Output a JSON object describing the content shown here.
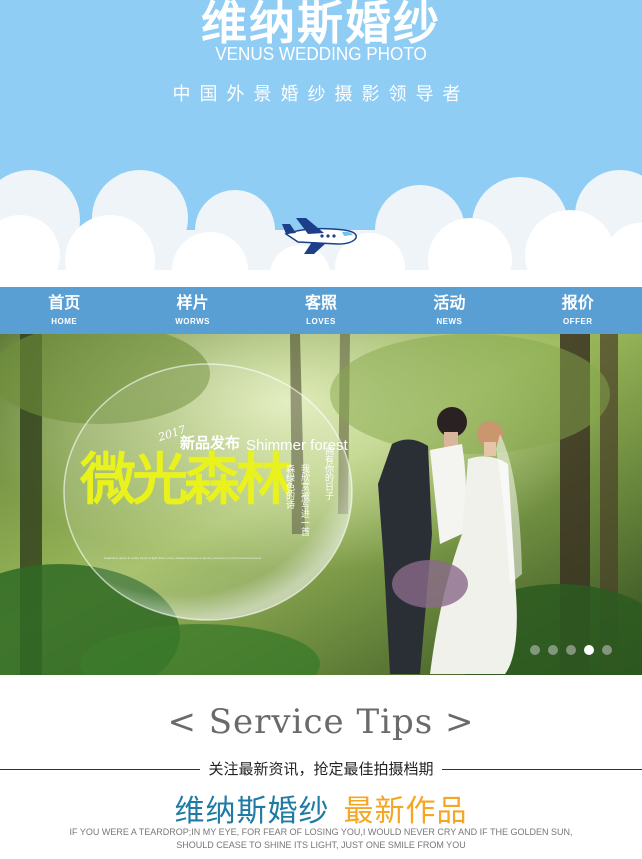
{
  "header": {
    "brand_title": "维纳斯婚纱",
    "brand_subtitle": "VENUS WEDDING PHOTO",
    "tagline": "中国外景婚纱摄影领导者"
  },
  "nav": {
    "items": [
      {
        "label": "首页",
        "en": "HOME"
      },
      {
        "label": "样片",
        "en": "WORWS"
      },
      {
        "label": "客照",
        "en": "LOVES"
      },
      {
        "label": "活动",
        "en": "NEWS"
      },
      {
        "label": "报价",
        "en": "OFFER"
      }
    ]
  },
  "banner": {
    "year": "2017",
    "release": "新品发布",
    "name_en": "Shimmer forest",
    "title": "微光森林",
    "poem_1": "森绿色的诗",
    "poem_2": "我欣赏被写进一首",
    "poem_3": "拥有你的日子",
    "small_text": "Happiness grows in a fairy forest of light where every whisper becomes a memory and every memory becomes forever",
    "slides": 5,
    "active_slide": 4
  },
  "service": {
    "title": "< Service Tips >",
    "subtitle": "关注最新资讯，抢定最佳拍摄档期",
    "works_brand": "维纳斯婚纱",
    "works_new": "最新作品",
    "quote_line1": "IF YOU WERE A TEARDROP;IN MY EYE, FOR FEAR OF LOSING YOU,I WOULD NEVER CRY AND IF THE GOLDEN SUN,",
    "quote_line2": "SHOULD CEASE TO SHINE ITS LIGHT, JUST ONE SMILE FROM YOU"
  },
  "colors": {
    "sky": "#8fcdf5",
    "nav": "#5a9fd4",
    "title_yellow": "#e9f21c",
    "brand_blue": "#1f7ba3",
    "accent_orange": "#f5a623"
  }
}
